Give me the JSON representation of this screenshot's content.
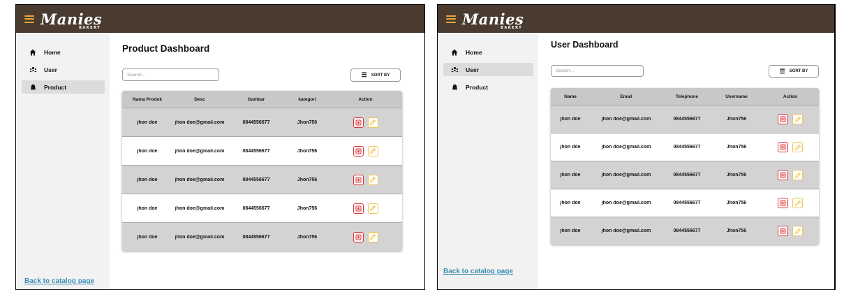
{
  "brand": {
    "name": "Manies",
    "sub": "BAKERY"
  },
  "sidebar": {
    "items": [
      {
        "label": "Home",
        "icon": "home-icon"
      },
      {
        "label": "User",
        "icon": "users-icon"
      },
      {
        "label": "Product",
        "icon": "product-icon"
      }
    ],
    "back_link": "Back to catalog page"
  },
  "product_panel": {
    "title": "Product Dashboard",
    "search_placeholder": "Search...",
    "sort_label": "SORT BY",
    "active_nav": "Product",
    "columns": [
      "Nama Produk",
      "Desc",
      "Gambar",
      "kategori",
      "Action"
    ],
    "rows": [
      [
        "jhon doe",
        "jhon doe@gmail.com",
        "0844556677",
        "Jhon756"
      ],
      [
        "jhon doe",
        "jhon doe@gmail.com",
        "0844556677",
        "Jhon756"
      ],
      [
        "jhon doe",
        "jhon doe@gmail.com",
        "0844556677",
        "Jhon756"
      ],
      [
        "jhon doe",
        "jhon doe@gmail.com",
        "0844556677",
        "Jhon756"
      ],
      [
        "jhon doe",
        "jhon doe@gmail.com",
        "0844556677",
        "Jhon756"
      ]
    ]
  },
  "user_panel": {
    "title": "User Dashboard",
    "search_placeholder": "Search...",
    "sort_label": "SORT BY",
    "active_nav": "User",
    "columns": [
      "Name",
      "Email",
      "Telephone",
      "Username",
      "Action"
    ],
    "rows": [
      [
        "jhon doe",
        "jhon doe@gmail.com",
        "0844556677",
        "Jhon756"
      ],
      [
        "jhon doe",
        "jhon doe@gmail.com",
        "0844556677",
        "Jhon756"
      ],
      [
        "jhon doe",
        "jhon doe@gmail.com",
        "0844556677",
        "Jhon756"
      ],
      [
        "jhon doe",
        "jhon doe@gmail.com",
        "0844556677",
        "Jhon756"
      ],
      [
        "jhon doe",
        "jhon doe@gmail.com",
        "0844556677",
        "Jhon756"
      ]
    ]
  },
  "colors": {
    "topbar": "#4a3b30",
    "accent": "#e9a83c",
    "delete": "#d9343a",
    "edit": "#f0c24b",
    "link": "#3b8fb3"
  }
}
